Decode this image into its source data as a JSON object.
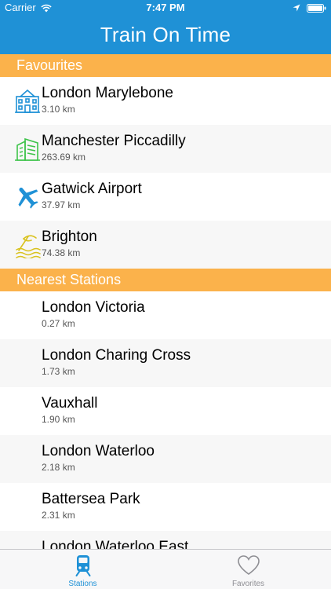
{
  "status_bar": {
    "carrier": "Carrier",
    "time": "7:47 PM",
    "icons": [
      "wifi-icon",
      "location-arrow-icon",
      "battery-icon"
    ]
  },
  "header": {
    "title": "Train On Time",
    "color": "#1f91d6"
  },
  "favourites": {
    "title": "Favourites",
    "items": [
      {
        "name": "London Marylebone",
        "distance": "3.10 km",
        "icon": "building-icon",
        "icon_color": "#1f91d6"
      },
      {
        "name": "Manchester Piccadilly",
        "distance": "263.69 km",
        "icon": "skyscraper-icon",
        "icon_color": "#3ec34a"
      },
      {
        "name": "Gatwick Airport",
        "distance": "37.97 km",
        "icon": "airplane-icon",
        "icon_color": "#1f91d6"
      },
      {
        "name": "Brighton",
        "distance": "74.38 km",
        "icon": "beach-icon",
        "icon_color": "#d9c21d"
      }
    ]
  },
  "nearest": {
    "title": "Nearest Stations",
    "items": [
      {
        "name": "London Victoria",
        "distance": "0.27 km"
      },
      {
        "name": "London Charing Cross",
        "distance": "1.73 km"
      },
      {
        "name": "Vauxhall",
        "distance": "1.90 km"
      },
      {
        "name": "London Waterloo",
        "distance": "2.18 km"
      },
      {
        "name": "Battersea Park",
        "distance": "2.31 km"
      },
      {
        "name": "London Waterloo East",
        "distance": ""
      }
    ]
  },
  "section_color": "#fbb24b",
  "tabs": [
    {
      "label": "Stations",
      "icon": "train-icon",
      "selected": true,
      "color": "#1f91d6"
    },
    {
      "label": "Favorites",
      "icon": "heart-icon",
      "selected": false,
      "color": "#8e8e93"
    }
  ]
}
